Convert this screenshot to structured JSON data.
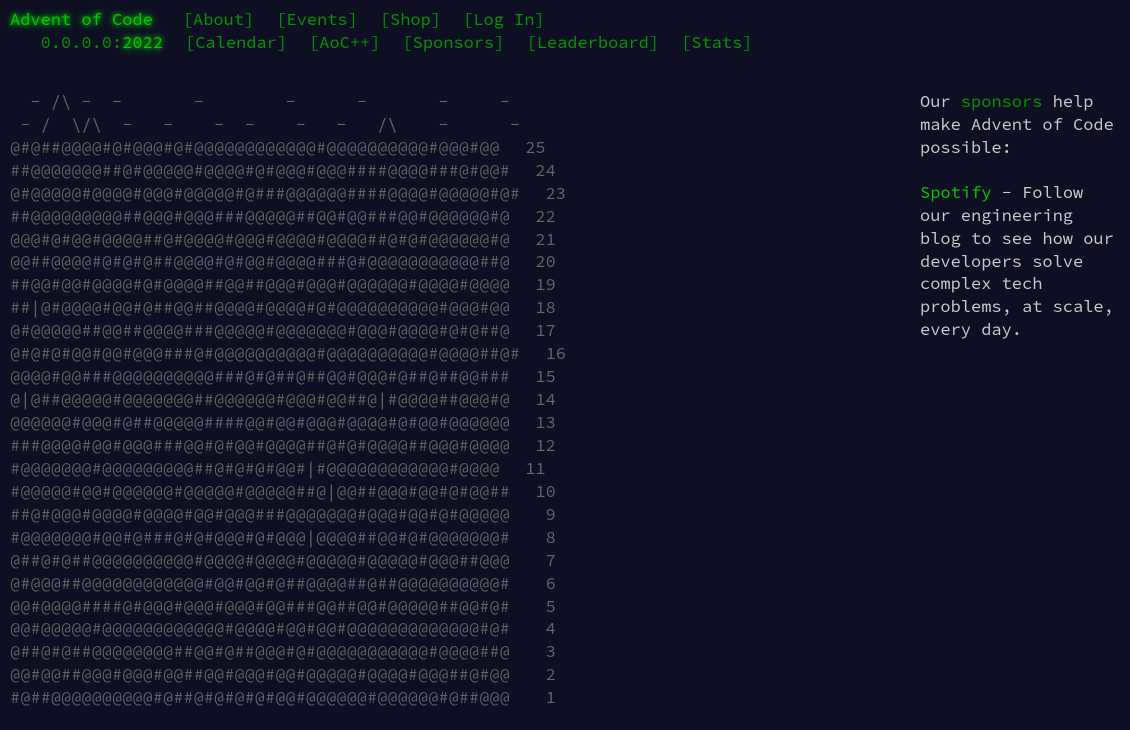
{
  "header": {
    "title": "Advent of Code",
    "nav1": [
      {
        "label": "About"
      },
      {
        "label": "Events"
      },
      {
        "label": "Shop"
      },
      {
        "label": "Log In"
      }
    ],
    "user": "0.0.0.0:",
    "year": "2022",
    "nav2": [
      {
        "label": "Calendar"
      },
      {
        "label": "AoC++"
      },
      {
        "label": "Sponsors"
      },
      {
        "label": "Leaderboard"
      },
      {
        "label": "Stats"
      }
    ]
  },
  "calendar": {
    "top_lines": [
      "  - /\\ -  -       -        -      -       -     -     ",
      " - /  \\/\\  -   -    -  -    -   -   /\\    -      -   "
    ],
    "days": [
      {
        "ascii": "@#@##@@@@#@#@@@#@#@@@@@@@@@@@@#@@@@@@@@@@#@@@#@@",
        "num": "25"
      },
      {
        "ascii": "##@@@@@@@##@#@@@@@#@@@@#@#@@@#@@@####@@@@###@#@@#",
        "num": "24"
      },
      {
        "ascii": "@#@@@@@#@@@@#@@@#@@@@@#@###@@@@@@####@@@@#@@@@@#@#",
        "num": "23"
      },
      {
        "ascii": "##@@@@@@@@@##@@@#@@@###@@@@@##@@#@@###@@#@@@@@@#@",
        "num": "22"
      },
      {
        "ascii": "@@@#@#@@#@@@@##@#@@@@#@@@#@@@@#@@@@##@#@#@@@@@@#@",
        "num": "21"
      },
      {
        "ascii": "@@##@@@@#@#@#@##@@@@#@#@@#@@@@###@#@@@@@@@@@@@##@",
        "num": "20"
      },
      {
        "ascii": "##@@#@@#@@@@#@#@@@@##@@##@@@#@@@#@@@@@@#@@@@#@@@@",
        "num": "19"
      },
      {
        "ascii": "##|@#@@@@#@@#@##@@##@@@@#@@@@#@#@@@@@@@@@@#@@@#@@",
        "num": "18"
      },
      {
        "ascii": "@#@@@@@##@@##@@@@###@@@@@#@@@@@@@#@@@#@@@@#@#@##@",
        "num": "17"
      },
      {
        "ascii": "@#@#@#@@#@@#@@@###@#@@@@@@@@@@#@@@@@@@@@@#@@@@##@#",
        "num": "16"
      },
      {
        "ascii": "@@@@#@@###@@@@@@@@@@###@#@##@##@@#@@@#@##@##@@###",
        "num": "15"
      },
      {
        "ascii": "@|@##@@@@@#@@@@@@@##@@@@@@#@@@#@@##@|#@@@@##@@@#@",
        "num": "14"
      },
      {
        "ascii": "@@@@@@#@@@#@##@@@@@####@@#@@#@@@#@@@@#@#@@#@@@@@@",
        "num": "13"
      },
      {
        "ascii": "###@@@@#@@#@@@###@@#@#@@#@@@@##@#@#@@@@##@@@#@@@@",
        "num": "12"
      },
      {
        "ascii": "#@@@@@@@#@@@@@@@@@##@#@#@#@@#|#@@@@@@@@@@@@#@@@@",
        "num": "11"
      },
      {
        "ascii": "#@@@@@#@@#@@@@@@#@@@@@#@@@@@##@|@@##@@@#@@#@#@@##",
        "num": "10"
      },
      {
        "ascii": "##@#@@@#@@@@#@@@@#@@#@@@###@@@@@@@#@@@#@@#@#@@@@@",
        "num": "9"
      },
      {
        "ascii": "#@@@@@@@#@@#@###@#@#@@@#@#@@@|@@@@##@@#@#@@@@@@@#",
        "num": "8"
      },
      {
        "ascii": "@##@#@##@@@@@@@@@@#@@@@#@@@@#@@@@@#@@@@@#@@@##@@@",
        "num": "7"
      },
      {
        "ascii": "@#@@@##@@@@@@@@@@@@#@@#@@#@##@@@@##@##@@@@@@@@@@#",
        "num": "6"
      },
      {
        "ascii": "@@#@@@@####@#@@@#@@@#@@@#@@###@@##@@#@@@@@##@@#@#",
        "num": "5"
      },
      {
        "ascii": "@@#@@@@@#@@@@@@@@@@@@#@@@@#@@#@@#@@@@@@@@@@@@@#@#",
        "num": "4"
      },
      {
        "ascii": "@##@#@##@@@@@@@@##@@#@##@@@#@#@@@@@@@@@@@#@@@@##@",
        "num": "3"
      },
      {
        "ascii": "@@#@@##@@@#@@@#@@##@@#@@@#@@#@@@@@#@@@@#@@@##@#@@",
        "num": "2"
      },
      {
        "ascii": "#@##@@@@@@@@@@#@##@#@#@#@#@@#@@@@@@#@@@@@@#@##@@@",
        "num": "1"
      }
    ]
  },
  "sidebar": {
    "intro_pre": "Our ",
    "sponsors_link": "sponsors",
    "intro_post": " help make Advent of Code possible:",
    "sponsor": {
      "name": "Spotify",
      "sep": " - ",
      "text": "Follow our engineering blog to see how our developers solve complex tech problems, at scale, every day."
    }
  }
}
